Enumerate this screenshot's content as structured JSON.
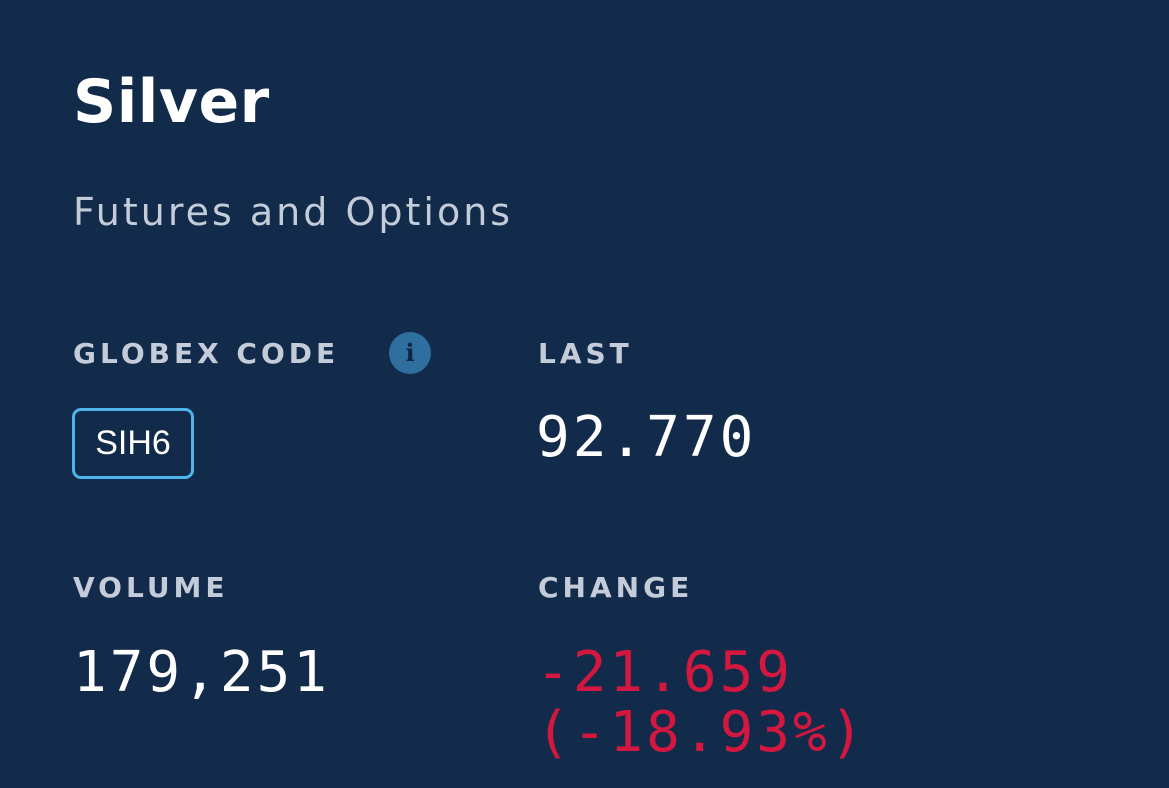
{
  "instrument": {
    "title": "Silver",
    "subtitle": "Futures and Options"
  },
  "globex": {
    "label": "GLOBEX CODE",
    "info_icon": "info-icon",
    "code": "SIH6"
  },
  "last": {
    "label": "LAST",
    "value": "92.770"
  },
  "volume": {
    "label": "VOLUME",
    "value": "179,251"
  },
  "change": {
    "label": "CHANGE",
    "value": "-21.659",
    "percent": "(-18.93%)"
  },
  "colors": {
    "background": "#132b4b",
    "text": "#ffffff",
    "label": "#c3ccd8",
    "accent": "#4fb3ec",
    "info": "#2f6f9f",
    "negative": "#d3173f"
  }
}
